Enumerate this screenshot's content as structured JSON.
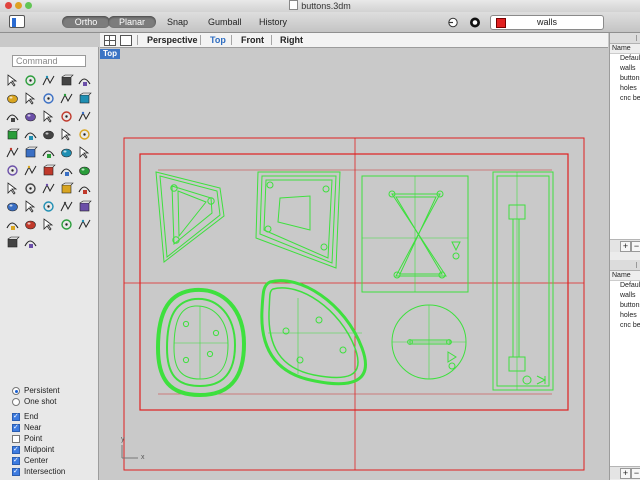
{
  "window": {
    "title": "buttons.3dm"
  },
  "toolbar": {
    "ortho": "Ortho",
    "planar": "Planar",
    "snap": "Snap",
    "gumball": "Gumball",
    "history": "History",
    "current_layer": "walls",
    "layer_color": "#e12020"
  },
  "viewport_tabs": {
    "perspective": "Perspective",
    "top": "Top",
    "front": "Front",
    "right": "Right",
    "active": "Top"
  },
  "viewport": {
    "label": "Top",
    "axis_x": "x",
    "axis_y": "y",
    "grid_color": "#e02020",
    "curve_color": "#3ee03e"
  },
  "command": {
    "placeholder": "Command"
  },
  "osnap": {
    "modes": [
      {
        "label": "Persistent",
        "selected": true
      },
      {
        "label": "One shot",
        "selected": false
      }
    ],
    "snaps": [
      {
        "label": "End",
        "checked": true
      },
      {
        "label": "Near",
        "checked": true
      },
      {
        "label": "Point",
        "checked": false
      },
      {
        "label": "Midpoint",
        "checked": true
      },
      {
        "label": "Center",
        "checked": true
      },
      {
        "label": "Intersection",
        "checked": true
      }
    ]
  },
  "layers_panel": {
    "header": "Name",
    "items": [
      "Default",
      "walls",
      "buttons",
      "holes",
      "cnc be"
    ],
    "add_label": "+",
    "remove_label": "−"
  },
  "layers_panel_2": {
    "header": "Name",
    "items": [
      "Default",
      "walls",
      "buttons",
      "holes",
      "cnc be"
    ],
    "add_label": "+",
    "remove_label": "−"
  },
  "tool_icons": [
    "select-arrow-icon",
    "point-icon",
    "polyline-icon",
    "curve-icon",
    "circle-icon",
    "arc-icon",
    "ellipse-icon",
    "rectangle-icon",
    "polygon-icon",
    "fillet-icon",
    "surface-icon",
    "extrude-icon",
    "loft-icon",
    "sweep-icon",
    "patch-icon",
    "box-icon",
    "sphere-icon",
    "cylinder-icon",
    "cone-icon",
    "torus-icon",
    "boolean-icon",
    "join-icon",
    "explode-icon",
    "trim-icon",
    "split-icon",
    "move-icon",
    "rotate-icon",
    "scale-icon",
    "mirror-icon",
    "array-icon",
    "grid-array-icon",
    "layer-icon",
    "group-icon",
    "check-icon",
    "dimension-icon",
    "text-icon",
    "zoom-icon",
    "pan-icon",
    "render-icon",
    "light-icon",
    "lock-icon",
    "material-icon",
    "color-icon",
    "environment-icon",
    "properties-icon",
    "globe-icon",
    "pen-icon"
  ]
}
